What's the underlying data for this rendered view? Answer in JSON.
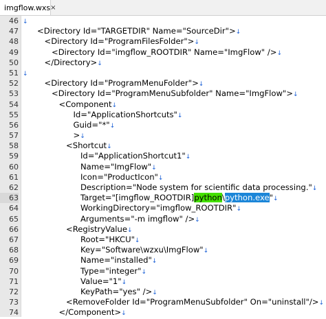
{
  "tab": {
    "title": "imgflow.wxs",
    "close_glyph": "×"
  },
  "eol_glyph": "↓",
  "lines": [
    {
      "num": "46",
      "indent": 0,
      "text": ""
    },
    {
      "num": "47",
      "indent": 2,
      "text": "<Directory Id=\"TARGETDIR\" Name=\"SourceDir\">"
    },
    {
      "num": "48",
      "indent": 3,
      "text": "<Directory Id=\"ProgramFilesFolder\">"
    },
    {
      "num": "49",
      "indent": 4,
      "text": "<Directory Id=\"imgflow_ROOTDIR\" Name=\"ImgFlow\" />"
    },
    {
      "num": "50",
      "indent": 3,
      "text": "</Directory>"
    },
    {
      "num": "51",
      "indent": 0,
      "text": ""
    },
    {
      "num": "52",
      "indent": 3,
      "text": "<Directory Id=\"ProgramMenuFolder\">"
    },
    {
      "num": "53",
      "indent": 4,
      "text": "<Directory Id=\"ProgramMenuSubfolder\" Name=\"ImgFlow\">"
    },
    {
      "num": "54",
      "indent": 5,
      "text": "<Component"
    },
    {
      "num": "55",
      "indent": 7,
      "text": "Id=\"ApplicationShortcuts\""
    },
    {
      "num": "56",
      "indent": 7,
      "text": "Guid=\"*\""
    },
    {
      "num": "57",
      "indent": 7,
      "text": ">"
    },
    {
      "num": "58",
      "indent": 6,
      "text": "<Shortcut"
    },
    {
      "num": "59",
      "indent": 8,
      "text": "Id=\"ApplicationShortcut1\""
    },
    {
      "num": "60",
      "indent": 8,
      "text": "Name=\"ImgFlow\""
    },
    {
      "num": "61",
      "indent": 8,
      "text": "Icon=\"ProductIcon\""
    },
    {
      "num": "62",
      "indent": 8,
      "text": "Description=\"Node system for scientific data processing.\""
    },
    {
      "num": "63",
      "indent": 8,
      "text": "",
      "current": true,
      "parts": [
        "Target=\"[imgflow_ROOTDIR]",
        "python",
        "\\",
        "python.exe",
        "\""
      ]
    },
    {
      "num": "64",
      "indent": 8,
      "text": "WorkingDirectory=\"imgflow_ROOTDIR\""
    },
    {
      "num": "65",
      "indent": 8,
      "text": "Arguments=\"-m imgflow\" />"
    },
    {
      "num": "66",
      "indent": 6,
      "text": "<RegistryValue"
    },
    {
      "num": "67",
      "indent": 8,
      "text": "Root=\"HKCU\""
    },
    {
      "num": "68",
      "indent": 8,
      "text": "Key=\"Software\\wzxu\\ImgFlow\""
    },
    {
      "num": "69",
      "indent": 8,
      "text": "Name=\"installed\""
    },
    {
      "num": "70",
      "indent": 8,
      "text": "Type=\"integer\""
    },
    {
      "num": "71",
      "indent": 8,
      "text": "Value=\"1\""
    },
    {
      "num": "72",
      "indent": 8,
      "text": "KeyPath=\"yes\" />"
    },
    {
      "num": "73",
      "indent": 6,
      "text": "<RemoveFolder Id=\"ProgramMenuSubfolder\" On=\"uninstall\"/>"
    },
    {
      "num": "74",
      "indent": 5,
      "text": "</Component>"
    }
  ]
}
